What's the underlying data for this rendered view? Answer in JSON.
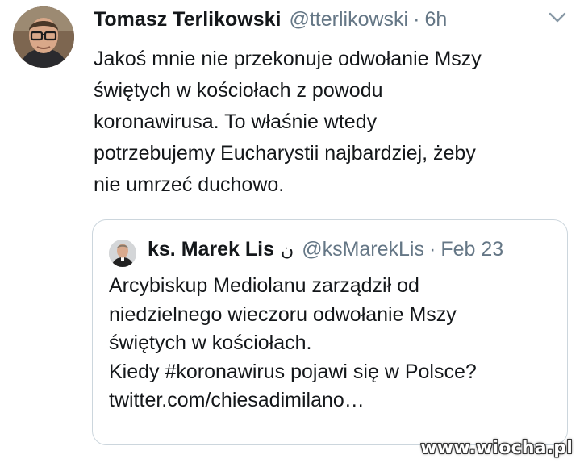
{
  "tweet": {
    "author_name": "Tomasz Terlikowski",
    "author_handle": "@tterlikowski",
    "separator": "·",
    "time": "6h",
    "menu_icon": "chevron-down-icon",
    "text_lines": [
      "Jakoś mnie nie przekonuje odwołanie Mszy",
      "świętych w kościołach z powodu",
      "koronawirusa. To właśnie wtedy",
      "potrzebujemy Eucharystii najbardziej, żeby",
      "nie umrzeć duchowo."
    ]
  },
  "quoted_tweet": {
    "author_name": "ks. Marek Lis",
    "name_glyph": "ن",
    "author_handle": "@ksMarekLis",
    "separator": "·",
    "time": "Feb 23",
    "text_lines": [
      "Arcybiskup Mediolanu zarządził od",
      "niedzielnego wieczoru odwołanie Mszy",
      "świętych w kościołach.",
      "Kiedy #koronawirus pojawi się w Polsce?",
      "twitter.com/chiesadimilano…"
    ]
  },
  "watermark": "www.wiocha.pl",
  "colors": {
    "text": "#14171a",
    "secondary_text": "#657786",
    "border": "#ccd6dd",
    "background": "#ffffff"
  }
}
